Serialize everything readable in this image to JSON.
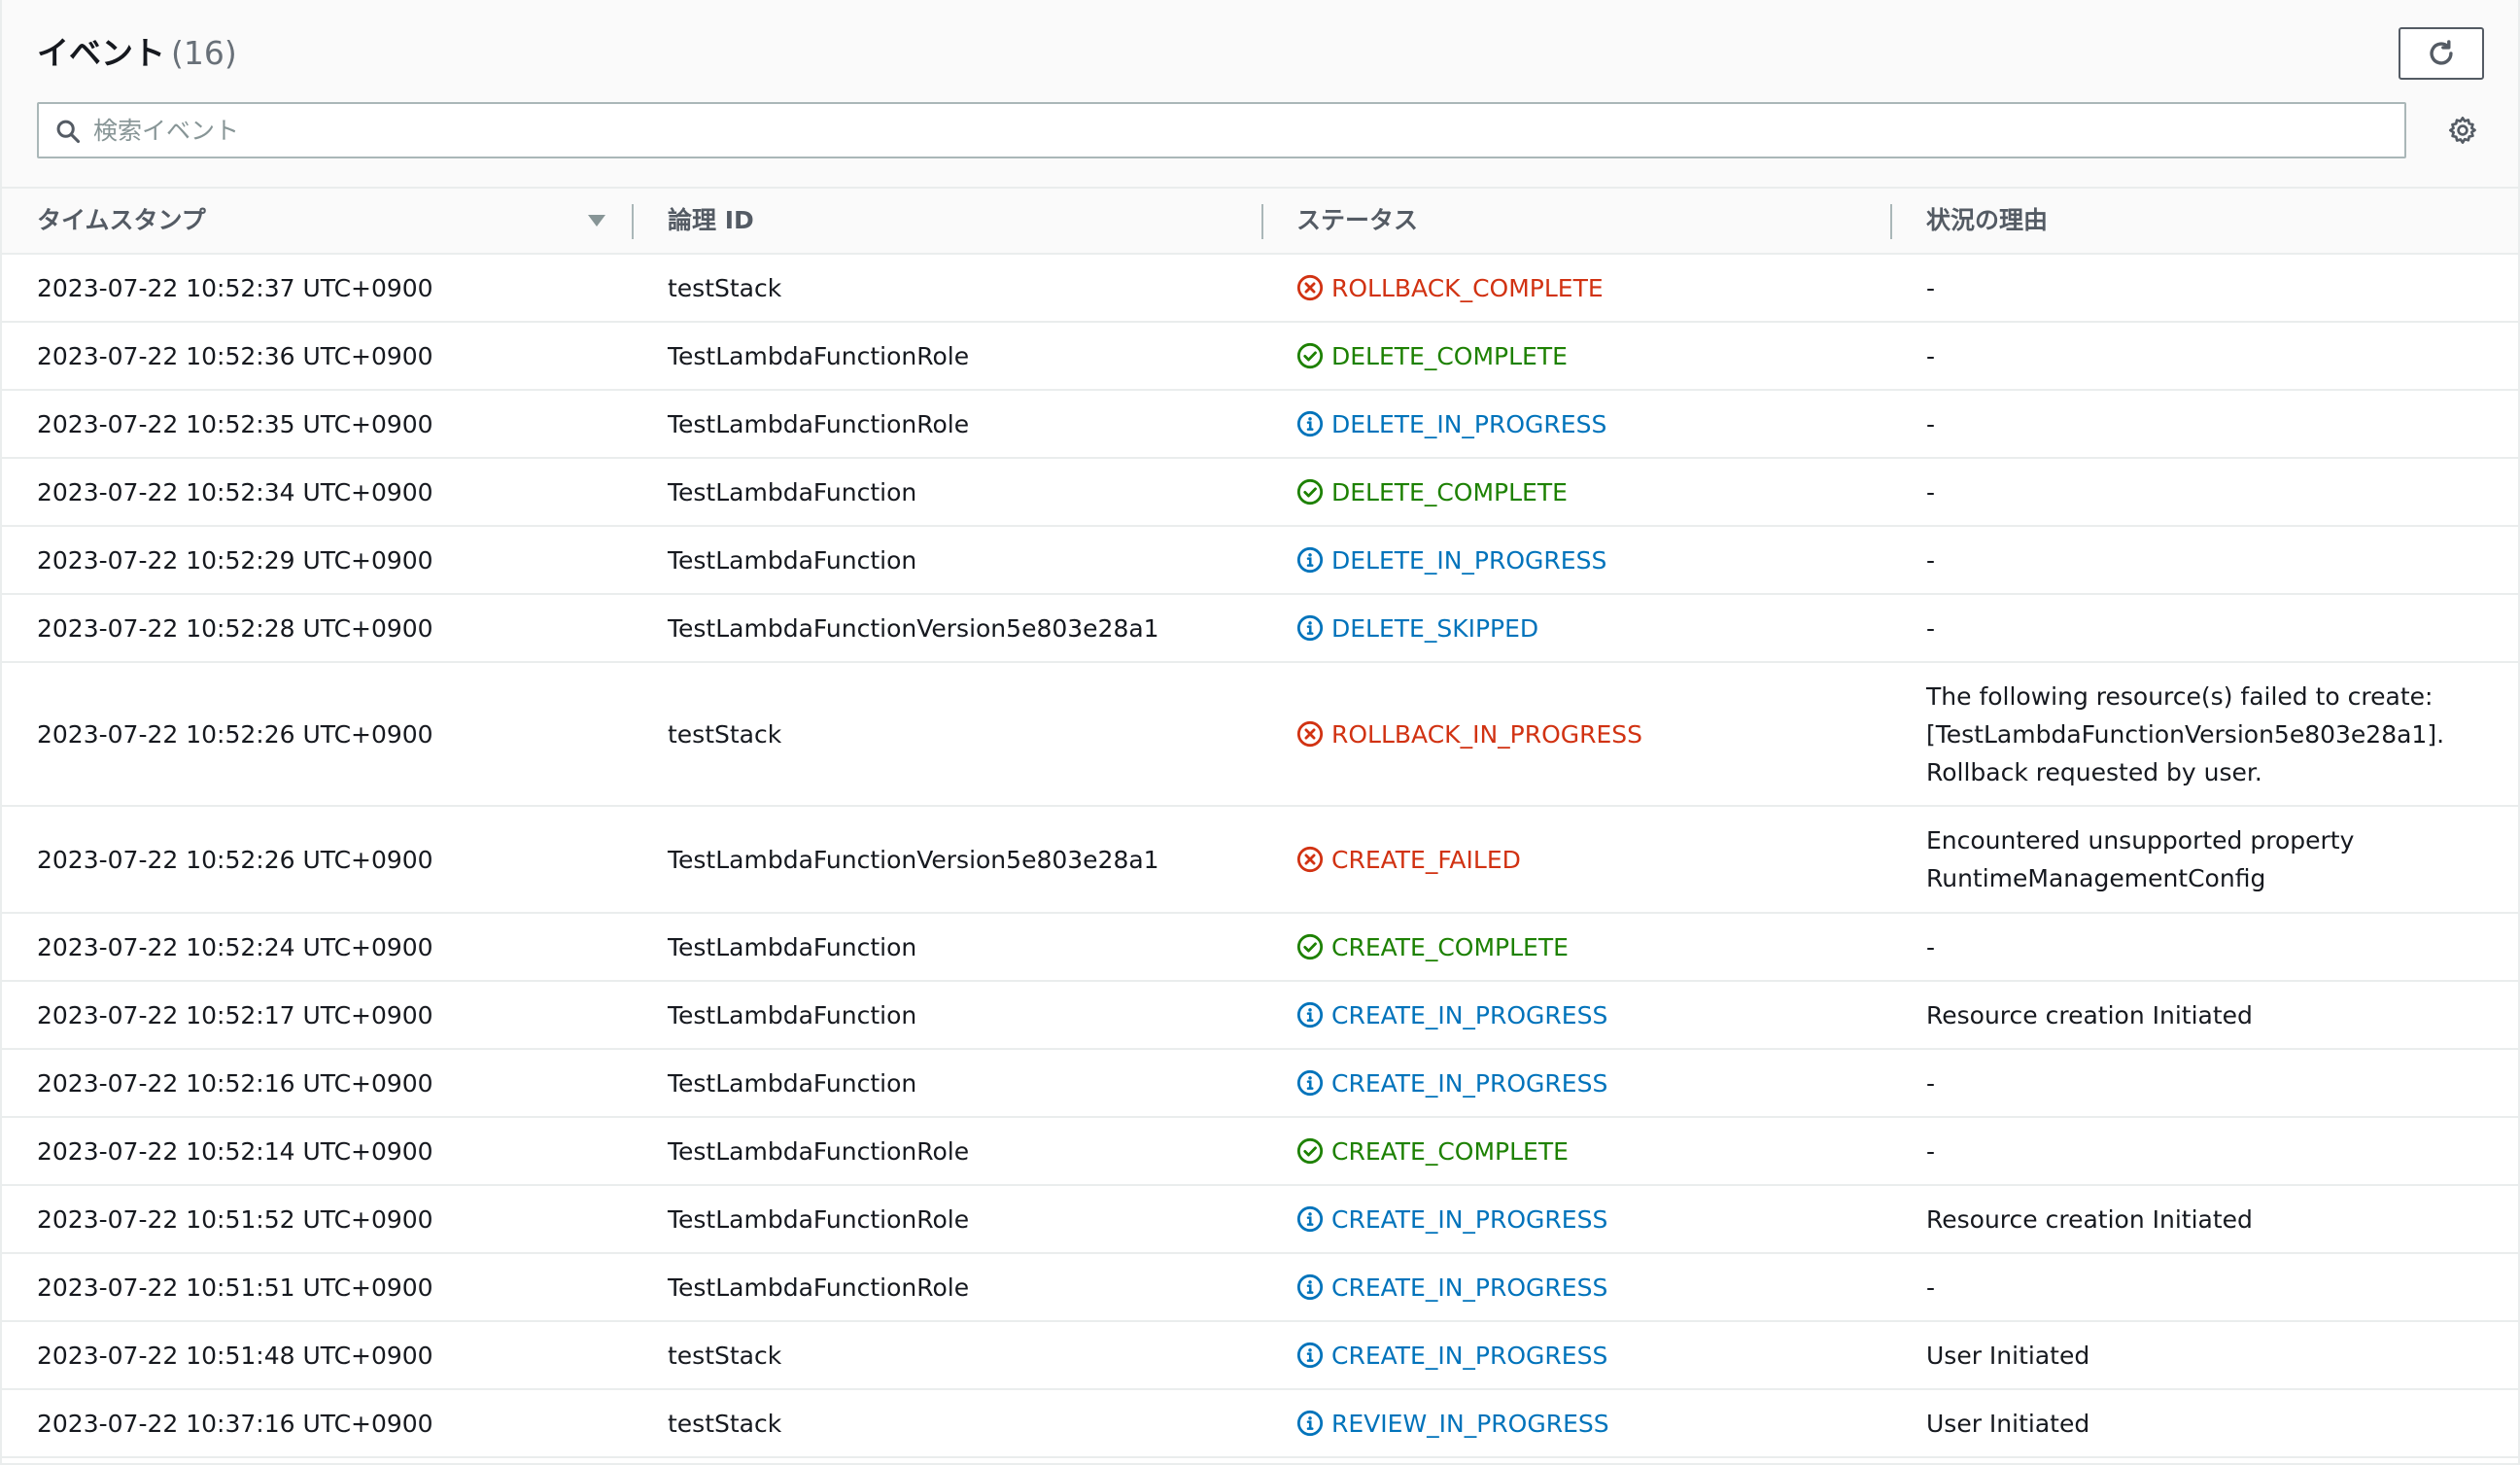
{
  "header": {
    "title": "イベント",
    "count": "(16)"
  },
  "search": {
    "placeholder": "検索イベント"
  },
  "icons": {
    "refresh": "refresh-icon",
    "search": "search-icon",
    "settings": "gear-icon",
    "sort": "sort-descending-icon",
    "status_failed": "error-circle-icon",
    "status_complete": "check-circle-icon",
    "status_progress": "info-circle-icon"
  },
  "colors": {
    "failed": "#d13212",
    "complete": "#1d8102",
    "progress": "#0073bb"
  },
  "columns": {
    "timestamp": "タイムスタンプ",
    "logical_id": "論理 ID",
    "status": "ステータス",
    "reason": "状況の理由"
  },
  "rows": [
    {
      "timestamp": "2023-07-22 10:52:37 UTC+0900",
      "logical_id": "testStack",
      "status": "ROLLBACK_COMPLETE",
      "status_kind": "failed",
      "reason": [
        "-"
      ]
    },
    {
      "timestamp": "2023-07-22 10:52:36 UTC+0900",
      "logical_id": "TestLambdaFunctionRole",
      "status": "DELETE_COMPLETE",
      "status_kind": "complete",
      "reason": [
        "-"
      ]
    },
    {
      "timestamp": "2023-07-22 10:52:35 UTC+0900",
      "logical_id": "TestLambdaFunctionRole",
      "status": "DELETE_IN_PROGRESS",
      "status_kind": "progress",
      "reason": [
        "-"
      ]
    },
    {
      "timestamp": "2023-07-22 10:52:34 UTC+0900",
      "logical_id": "TestLambdaFunction",
      "status": "DELETE_COMPLETE",
      "status_kind": "complete",
      "reason": [
        "-"
      ]
    },
    {
      "timestamp": "2023-07-22 10:52:29 UTC+0900",
      "logical_id": "TestLambdaFunction",
      "status": "DELETE_IN_PROGRESS",
      "status_kind": "progress",
      "reason": [
        "-"
      ]
    },
    {
      "timestamp": "2023-07-22 10:52:28 UTC+0900",
      "logical_id": "TestLambdaFunctionVersion5e803e28a1",
      "status": "DELETE_SKIPPED",
      "status_kind": "progress",
      "reason": [
        "-"
      ]
    },
    {
      "timestamp": "2023-07-22 10:52:26 UTC+0900",
      "logical_id": "testStack",
      "status": "ROLLBACK_IN_PROGRESS",
      "status_kind": "failed",
      "reason": [
        "The following resource(s) failed to create:",
        "[TestLambdaFunctionVersion5e803e28a1].",
        "Rollback requested by user."
      ]
    },
    {
      "timestamp": "2023-07-22 10:52:26 UTC+0900",
      "logical_id": "TestLambdaFunctionVersion5e803e28a1",
      "status": "CREATE_FAILED",
      "status_kind": "failed",
      "reason": [
        "Encountered unsupported property",
        "RuntimeManagementConfig"
      ]
    },
    {
      "timestamp": "2023-07-22 10:52:24 UTC+0900",
      "logical_id": "TestLambdaFunction",
      "status": "CREATE_COMPLETE",
      "status_kind": "complete",
      "reason": [
        "-"
      ]
    },
    {
      "timestamp": "2023-07-22 10:52:17 UTC+0900",
      "logical_id": "TestLambdaFunction",
      "status": "CREATE_IN_PROGRESS",
      "status_kind": "progress",
      "reason": [
        "Resource creation Initiated"
      ]
    },
    {
      "timestamp": "2023-07-22 10:52:16 UTC+0900",
      "logical_id": "TestLambdaFunction",
      "status": "CREATE_IN_PROGRESS",
      "status_kind": "progress",
      "reason": [
        "-"
      ]
    },
    {
      "timestamp": "2023-07-22 10:52:14 UTC+0900",
      "logical_id": "TestLambdaFunctionRole",
      "status": "CREATE_COMPLETE",
      "status_kind": "complete",
      "reason": [
        "-"
      ]
    },
    {
      "timestamp": "2023-07-22 10:51:52 UTC+0900",
      "logical_id": "TestLambdaFunctionRole",
      "status": "CREATE_IN_PROGRESS",
      "status_kind": "progress",
      "reason": [
        "Resource creation Initiated"
      ]
    },
    {
      "timestamp": "2023-07-22 10:51:51 UTC+0900",
      "logical_id": "TestLambdaFunctionRole",
      "status": "CREATE_IN_PROGRESS",
      "status_kind": "progress",
      "reason": [
        "-"
      ]
    },
    {
      "timestamp": "2023-07-22 10:51:48 UTC+0900",
      "logical_id": "testStack",
      "status": "CREATE_IN_PROGRESS",
      "status_kind": "progress",
      "reason": [
        "User Initiated"
      ]
    },
    {
      "timestamp": "2023-07-22 10:37:16 UTC+0900",
      "logical_id": "testStack",
      "status": "REVIEW_IN_PROGRESS",
      "status_kind": "progress",
      "reason": [
        "User Initiated"
      ]
    }
  ]
}
